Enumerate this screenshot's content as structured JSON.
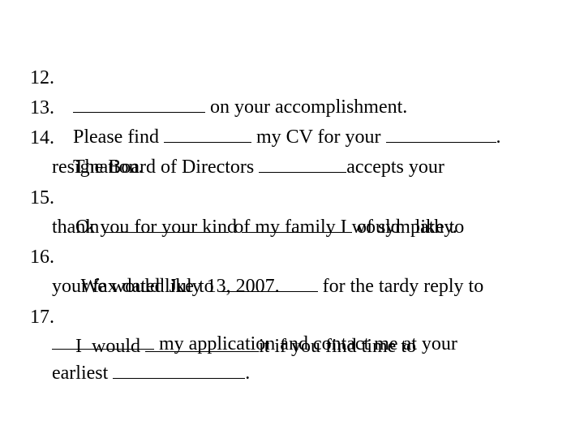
{
  "items": [
    {
      "number": "12.",
      "lines": [
        {
          "segments": [
            "",
            " on your accomplishment."
          ]
        }
      ]
    },
    {
      "number": "13.",
      "lines": [
        {
          "segments": [
            "Please find ",
            " my CV for your ",
            "."
          ]
        }
      ]
    },
    {
      "number": "14.",
      "lines": [
        {
          "segments": [
            "The Board of Directors ",
            "accepts your"
          ]
        },
        {
          "segments": [
            "resignation."
          ]
        }
      ]
    },
    {
      "number": "15.",
      "lines": [
        {
          "segments": [
            "On ",
            " of my family I would   like to"
          ]
        },
        {
          "segments": [
            "thank you for your kind ",
            " of sympathy."
          ]
        }
      ]
    },
    {
      "number": "16.",
      "lines": [
        {
          "segments": [
            " We would like to ",
            " for the tardy reply to"
          ]
        },
        {
          "segments": [
            "your fax dated July 13, 2007."
          ]
        }
      ]
    },
    {
      "number": "17.",
      "lines": [
        {
          "segments": [
            "I  would ",
            "it if you find time to"
          ]
        },
        {
          "segments": [
            "",
            " my application and contact me at your"
          ]
        },
        {
          "segments": [
            "earliest ",
            "."
          ]
        }
      ]
    }
  ]
}
